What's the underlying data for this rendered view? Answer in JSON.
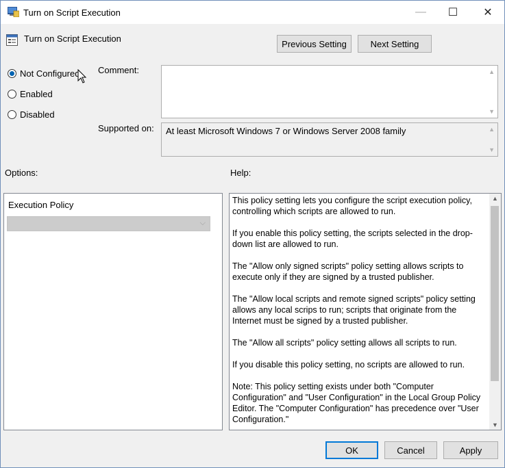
{
  "window": {
    "title": "Turn on Script Execution",
    "controls": {
      "minimize": "—",
      "maximize": "☐",
      "close": "✕"
    }
  },
  "header": {
    "setting_name": "Turn on Script Execution",
    "prev_label": "Previous Setting",
    "next_label": "Next Setting"
  },
  "state": {
    "options": [
      {
        "label": "Not Configured",
        "selected": true
      },
      {
        "label": "Enabled",
        "selected": false
      },
      {
        "label": "Disabled",
        "selected": false
      }
    ]
  },
  "comment": {
    "label": "Comment:",
    "value": ""
  },
  "supported": {
    "label": "Supported on:",
    "value": "At least Microsoft Windows 7 or Windows Server 2008 family"
  },
  "options_panel": {
    "label": "Options:",
    "field_label": "Execution Policy",
    "selected_value": ""
  },
  "help_panel": {
    "label": "Help:",
    "paragraphs": [
      "This policy setting lets you configure the script execution policy, controlling which scripts are allowed to run.",
      "If you enable this policy setting, the scripts selected in the drop-down list are allowed to run.",
      "The \"Allow only signed scripts\" policy setting allows scripts to execute only if they are signed by a trusted publisher.",
      "The \"Allow local scripts and remote signed scripts\" policy setting allows any local scrips to run; scripts that originate from the Internet must be signed by a trusted publisher.",
      "The \"Allow all scripts\" policy setting allows all scripts to run.",
      "If you disable this policy setting, no scripts are allowed to run.",
      "Note: This policy setting exists under both \"Computer Configuration\" and \"User Configuration\" in the Local Group Policy Editor. The \"Computer Configuration\" has precedence over \"User Configuration.\""
    ]
  },
  "footer": {
    "ok_label": "OK",
    "cancel_label": "Cancel",
    "apply_label": "Apply"
  },
  "colors": {
    "accent": "#0078d7",
    "radio_fill": "#0063b1",
    "disabled_combo": "#cccccc"
  }
}
